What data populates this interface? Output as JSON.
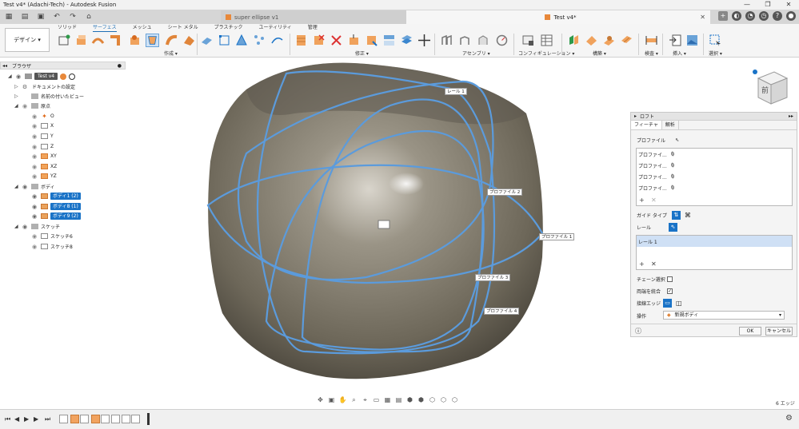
{
  "window": {
    "title": "Test v4* (Adachi-Tech) - Autodesk Fusion",
    "controls": [
      "—",
      "❐",
      "✕"
    ]
  },
  "tabs": {
    "inactive_label": "super ellipse v1",
    "active_label": "Test v4*"
  },
  "ribbon": {
    "workspace_label": "デザイン ▾",
    "tabs": [
      "ソリッド",
      "サーフェス",
      "メッシュ",
      "シート メタル",
      "プラスチック",
      "ユーティリティ",
      "管理"
    ],
    "groups": [
      "作成 ▾",
      "修正 ▾",
      "アセンブリ ▾",
      "コンフィギュレーション ▾",
      "構築 ▾",
      "検査 ▾",
      "挿入 ▾",
      "選択 ▾"
    ]
  },
  "browser": {
    "header": "ブラウザ",
    "root": "Test v4",
    "items": [
      {
        "label": "ドキュメントの設定"
      },
      {
        "label": "名前の付いたビュー"
      },
      {
        "label": "原点"
      },
      {
        "label": "O"
      },
      {
        "label": "X"
      },
      {
        "label": "Y"
      },
      {
        "label": "Z"
      },
      {
        "label": "XY"
      },
      {
        "label": "XZ"
      },
      {
        "label": "YZ"
      },
      {
        "label": "ボディ"
      },
      {
        "label": "ボディ1 (2)"
      },
      {
        "label": "ボディ8 (1)"
      },
      {
        "label": "ボディ9 (2)"
      },
      {
        "label": "スケッチ"
      },
      {
        "label": "スケッチ6"
      },
      {
        "label": "スケッチ8"
      }
    ]
  },
  "viewport": {
    "callouts": [
      "レール 1",
      "プロファイル 2",
      "プロファイル 1",
      "プロファイル 3",
      "プロファイル 4"
    ],
    "viewcube_face": "前"
  },
  "loft": {
    "title": "ロフト",
    "tabs": [
      "フィーチャ",
      "解析"
    ],
    "profile_label": "プロファイル",
    "profiles": [
      "プロファイ...",
      "プロファイ...",
      "プロファイ...",
      "プロファイ..."
    ],
    "guide_type_label": "ガイド タイプ",
    "rail_label": "レール",
    "rails": [
      "レール 1"
    ],
    "chain_label": "チェーン選択",
    "merge_ends_label": "両端を統合",
    "tangent_edges_label": "接線エッジ",
    "operation_label": "操作",
    "operation_value": "新規ボディ",
    "ok_label": "OK",
    "cancel_label": "キャンセル",
    "info_icon": "ⓘ"
  },
  "status": {
    "selection_count": "6 エッジ"
  },
  "colors": {
    "accent": "#1a73c7",
    "rail_curve": "#5b9bdc",
    "body_surface": "#7a7466"
  }
}
